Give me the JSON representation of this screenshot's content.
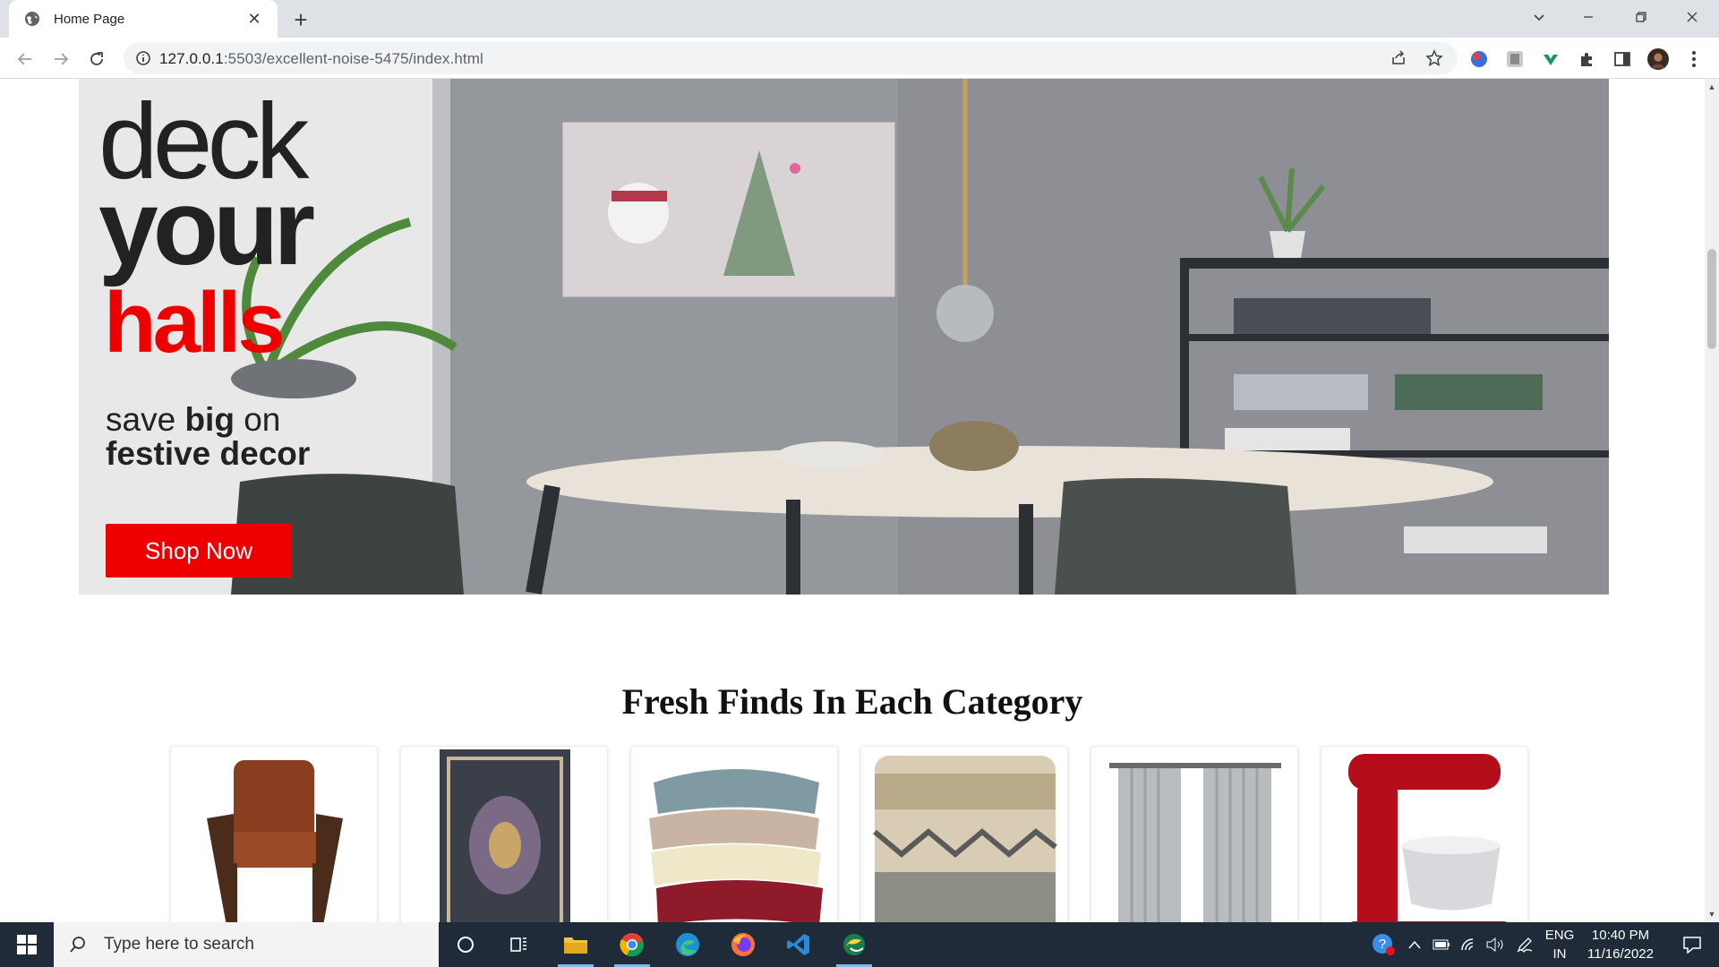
{
  "browser": {
    "tab_title": "Home Page",
    "url_host": "127.0.0.1",
    "url_rest": ":5503/excellent-noise-5475/index.html"
  },
  "hero": {
    "line1": "deck",
    "line2": "your",
    "line3": "halls",
    "sub_prefix": "save",
    "sub_bold": "big",
    "sub_suffix": "on",
    "sub_line2": "festive decor",
    "button_label": "Shop Now",
    "accent_color": "#ee0000"
  },
  "section": {
    "title": "Fresh Finds In Each Category"
  },
  "categories": [
    {
      "icon": "armchair-image"
    },
    {
      "icon": "rug-image"
    },
    {
      "icon": "throw-blankets-image"
    },
    {
      "icon": "pillow-image"
    },
    {
      "icon": "curtains-image"
    },
    {
      "icon": "stand-mixer-image"
    }
  ],
  "taskbar": {
    "search_placeholder": "Type here to search",
    "lang_top": "ENG",
    "lang_bottom": "IN",
    "time": "10:40 PM",
    "date": "11/16/2022"
  }
}
